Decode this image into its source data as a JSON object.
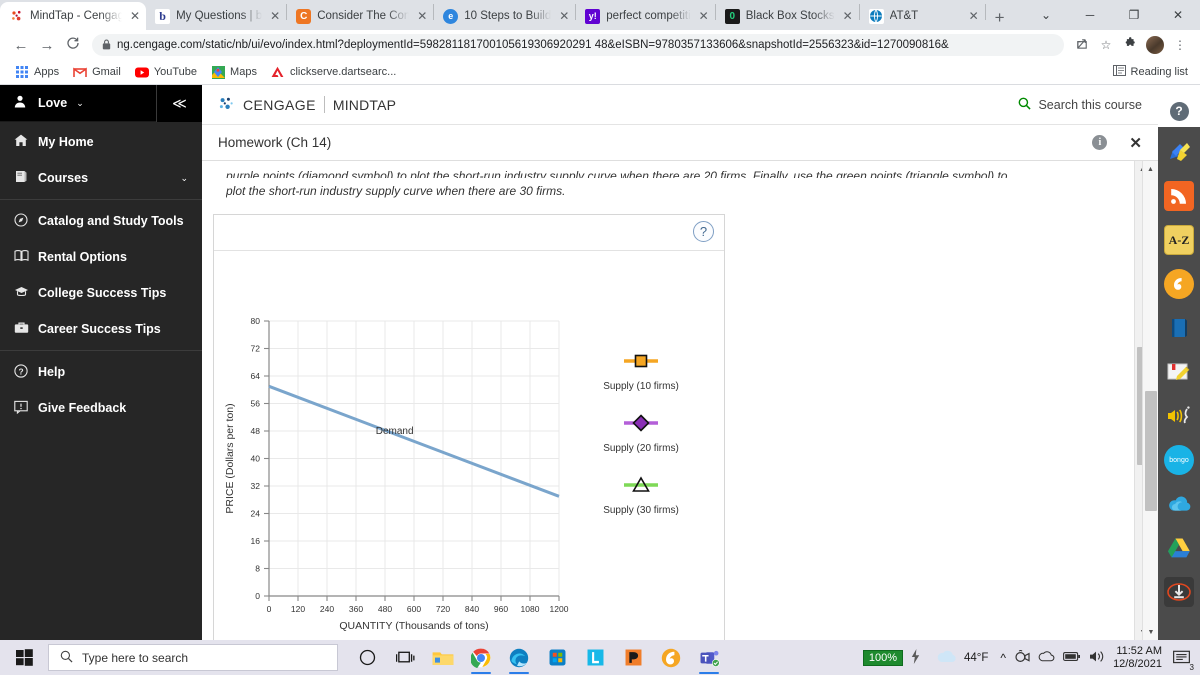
{
  "browser": {
    "tabs": [
      {
        "title": "MindTap - Cengag",
        "icon": "cengage-icon",
        "active": true
      },
      {
        "title": "My Questions | b",
        "icon": "bartleby-icon",
        "active": false
      },
      {
        "title": "Consider The Con",
        "icon": "chegg-icon",
        "active": false
      },
      {
        "title": "10 Steps to Build",
        "icon": "generic-blue-icon",
        "active": false
      },
      {
        "title": "perfect competiti",
        "icon": "yahoo-icon",
        "active": false
      },
      {
        "title": "Black Box Stocks",
        "icon": "blackbox-icon",
        "active": false
      },
      {
        "title": "AT&T",
        "icon": "att-globe-icon",
        "active": false
      }
    ],
    "new_tab_label": "+",
    "tab_close_label": "✕",
    "window_controls": [
      "⌄",
      "─",
      "❐",
      "✕"
    ],
    "nav": {
      "back": "←",
      "forward": "→",
      "reload": "C"
    },
    "url": "ng.cengage.com/static/nb/ui/evo/index.html?deploymentId=598281181700105619306920291 48&eISBN=9780357133606&snapshotId=2556323&id=1270090816&",
    "url_lock": "🔒",
    "omnibox_icons": [
      "share-icon",
      "bookmark-star-icon",
      "extensions-puzzle-icon"
    ],
    "menu_icon": "⋮",
    "bookmarks": [
      {
        "label": "Apps",
        "icon": "apps-grid-icon"
      },
      {
        "label": "Gmail",
        "icon": "gmail-icon"
      },
      {
        "label": "YouTube",
        "icon": "youtube-icon"
      },
      {
        "label": "Maps",
        "icon": "maps-icon"
      },
      {
        "label": "clickserve.dartsearc...",
        "icon": "adobe-icon"
      }
    ],
    "reading_list": "Reading list"
  },
  "sidebar": {
    "user": "Love",
    "user_caret": "⌄",
    "collapse_icon": "≪",
    "items": [
      {
        "label": "My Home",
        "icon": "home-icon",
        "chevron": ""
      },
      {
        "label": "Courses",
        "icon": "book-icon",
        "chevron": "⌄"
      },
      {
        "label": "Catalog and Study Tools",
        "icon": "compass-icon",
        "chevron": ""
      },
      {
        "label": "Rental Options",
        "icon": "open-book-icon",
        "chevron": ""
      },
      {
        "label": "College Success Tips",
        "icon": "graduation-cap-icon",
        "chevron": ""
      },
      {
        "label": "Career Success Tips",
        "icon": "briefcase-icon",
        "chevron": ""
      },
      {
        "label": "Help",
        "icon": "question-circle-icon",
        "chevron": ""
      },
      {
        "label": "Give Feedback",
        "icon": "feedback-icon",
        "chevron": ""
      }
    ]
  },
  "header": {
    "brand": "CENGAGE",
    "brand2": "MINDTAP",
    "search_label": "Search this course",
    "search_icon": "search-icon"
  },
  "homework": {
    "title": "Homework (Ch 14)",
    "info_label": "i",
    "close_label": "✕"
  },
  "instructions": {
    "line1": "purple points (diamond symbol) to plot the short-run industry supply curve when there are 20 firms. Finally, use the green points (triangle symbol) to",
    "line2": "plot the short-run industry supply curve when there are 30 firms."
  },
  "panel": {
    "help_label": "?"
  },
  "chart_data": {
    "type": "line",
    "title": "",
    "xlabel": "QUANTITY (Thousands of tons)",
    "ylabel": "PRICE (Dollars per ton)",
    "xlim": [
      0,
      1200
    ],
    "ylim": [
      0,
      80
    ],
    "xticks": [
      0,
      120,
      240,
      360,
      480,
      600,
      720,
      840,
      960,
      1080,
      1200
    ],
    "yticks": [
      0,
      8,
      16,
      24,
      32,
      40,
      48,
      56,
      64,
      72,
      80
    ],
    "grid": true,
    "legend_position": "right",
    "series": [
      {
        "name": "Demand",
        "type": "line",
        "color": "#7aa5cc",
        "annotation": "Demand",
        "annotation_x": 520,
        "annotation_y": 48,
        "points": [
          {
            "x": 0,
            "y": 61
          },
          {
            "x": 1200,
            "y": 29
          }
        ]
      },
      {
        "name": "Supply (10 firms)",
        "type": "marker-only",
        "marker": "square",
        "color": "#f5a623",
        "line_color": "#f5a623",
        "points": []
      },
      {
        "name": "Supply (20 firms)",
        "type": "marker-only",
        "marker": "diamond",
        "color": "#9b3fc4",
        "line_color": "#b45fd8",
        "points": []
      },
      {
        "name": "Supply (30 firms)",
        "type": "marker-only",
        "marker": "triangle",
        "color": "#7ed957",
        "line_color": "#7ed957",
        "points": []
      }
    ],
    "legend": [
      {
        "label": "Supply (10 firms)",
        "marker": "square",
        "color": "#f5a623"
      },
      {
        "label": "Supply (20 firms)",
        "marker": "diamond",
        "color": "#b45fd8"
      },
      {
        "label": "Supply (30 firms)",
        "marker": "triangle",
        "color": "#7ed957"
      }
    ]
  },
  "right_rail": {
    "help_icon": "?",
    "items": [
      {
        "name": "highlighter-pen-icon"
      },
      {
        "name": "rss-feed-icon"
      },
      {
        "name": "dictionary-az-icon"
      },
      {
        "name": "brainfuse-icon"
      },
      {
        "name": "ebook-icon"
      },
      {
        "name": "notes-icon"
      },
      {
        "name": "read-aloud-icon"
      },
      {
        "name": "bongo-icon",
        "label": "bongo"
      },
      {
        "name": "onedrive-icon"
      },
      {
        "name": "google-drive-icon"
      },
      {
        "name": "download-icon"
      }
    ]
  },
  "taskbar": {
    "search_placeholder": "Type here to search",
    "search_icon": "search-icon",
    "start_icon": "windows-start-icon",
    "pinned": [
      {
        "name": "cortana-icon"
      },
      {
        "name": "task-view-icon"
      },
      {
        "name": "file-explorer-icon"
      },
      {
        "name": "chrome-icon"
      },
      {
        "name": "edge-icon"
      },
      {
        "name": "microsoft-store-icon"
      },
      {
        "name": "lockdown-browser-icon"
      },
      {
        "name": "photoshop-icon"
      },
      {
        "name": "cengage-icon"
      },
      {
        "name": "microsoft-teams-icon"
      }
    ],
    "battery_percent": "100%",
    "battery_icon": "charging-bolt-icon",
    "weather": "44°F",
    "weather_icon": "cloud-icon",
    "tray_icons": [
      "chevron-up-icon",
      "webcam-icon",
      "onedrive-cloud-icon",
      "battery-icon",
      "volume-icon"
    ],
    "time": "11:52 AM",
    "date": "12/8/2021",
    "notification_count": "3"
  }
}
